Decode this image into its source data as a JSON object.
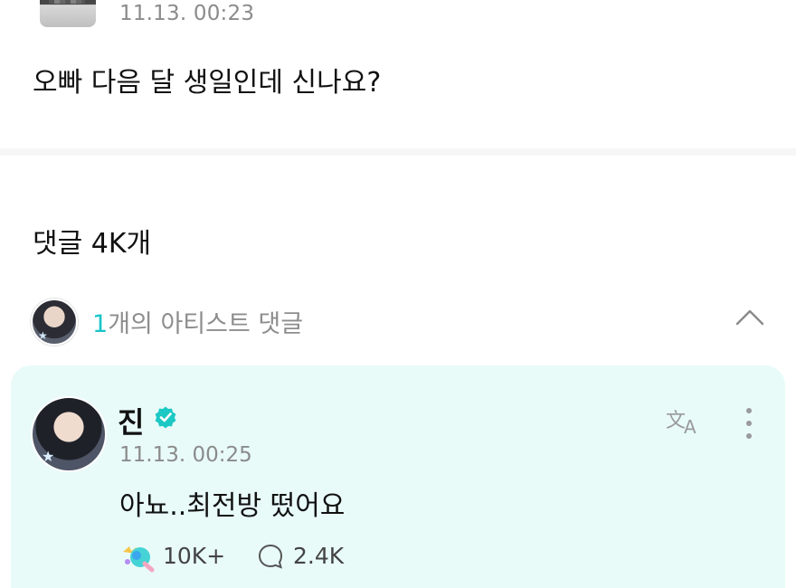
{
  "post": {
    "timestamp": "11.13. 00:23",
    "text": "오빠 다음 달 생일인데 신나요?"
  },
  "comments": {
    "count_label": "댓글 4K개"
  },
  "artist_section": {
    "count": "1",
    "label_suffix": "개의 아티스트 댓글",
    "icons": {
      "collapse": "chevron-up-icon"
    }
  },
  "artist_comment": {
    "author": "진",
    "timestamp": "11.13. 00:25",
    "text": "아뇨..최전방 떴어요",
    "likes": "10K+",
    "replies": "2.4K",
    "icons": {
      "verified": "verified-badge-icon",
      "translate": "translate-icon",
      "more": "more-vertical-icon",
      "like": "like-reaction-icon",
      "reply": "reply-bubble-icon"
    }
  },
  "colors": {
    "accent": "#18c4c9",
    "card_background": "#e8fbf9",
    "secondary_text": "#8b8b8b"
  }
}
